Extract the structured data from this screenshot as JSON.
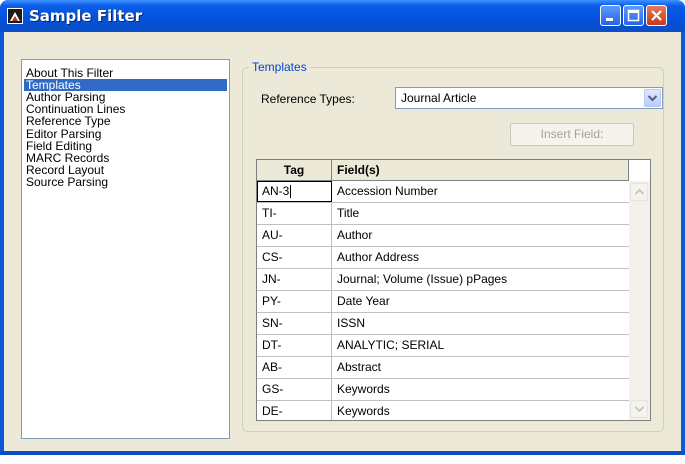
{
  "window": {
    "title": "Sample Filter"
  },
  "sidebar": {
    "items": [
      {
        "label": "About This Filter",
        "selected": false
      },
      {
        "label": "Templates",
        "selected": true
      },
      {
        "label": "Author Parsing",
        "selected": false
      },
      {
        "label": "Continuation Lines",
        "selected": false
      },
      {
        "label": "Reference Type",
        "selected": false
      },
      {
        "label": "Editor Parsing",
        "selected": false
      },
      {
        "label": "Field Editing",
        "selected": false
      },
      {
        "label": "MARC Records",
        "selected": false
      },
      {
        "label": "Record Layout",
        "selected": false
      },
      {
        "label": "Source Parsing",
        "selected": false
      }
    ]
  },
  "templates": {
    "group_title": "Templates",
    "reference_types_label": "Reference Types:",
    "reference_type_value": "Journal Article",
    "insert_field_label": "Insert Field:",
    "insert_field_enabled": false,
    "columns": {
      "tag": "Tag",
      "fields": "Field(s)"
    },
    "rows": [
      {
        "tag": "AN-3",
        "field": "Accession Number"
      },
      {
        "tag": "TI-",
        "field": "Title"
      },
      {
        "tag": "AU-",
        "field": "Author"
      },
      {
        "tag": "CS-",
        "field": "Author Address"
      },
      {
        "tag": "JN-",
        "field": "Journal; Volume (Issue) pPages"
      },
      {
        "tag": "PY-",
        "field": "Date Year"
      },
      {
        "tag": "SN-",
        "field": "ISSN"
      },
      {
        "tag": "DT-",
        "field": "ANALYTIC; SERIAL"
      },
      {
        "tag": "AB-",
        "field": "Abstract"
      },
      {
        "tag": "GS-",
        "field": "Keywords"
      },
      {
        "tag": "DE-",
        "field": "Keywords"
      }
    ]
  },
  "colors": {
    "titlebar": "#0451dc",
    "selection": "#316ac5",
    "group_title": "#0046d5",
    "dialog_face": "#ece9d8"
  },
  "icons": [
    "app-icon",
    "minimize-icon",
    "maximize-icon",
    "close-icon",
    "chevron-down-icon",
    "scroll-up-icon",
    "scroll-down-icon"
  ]
}
